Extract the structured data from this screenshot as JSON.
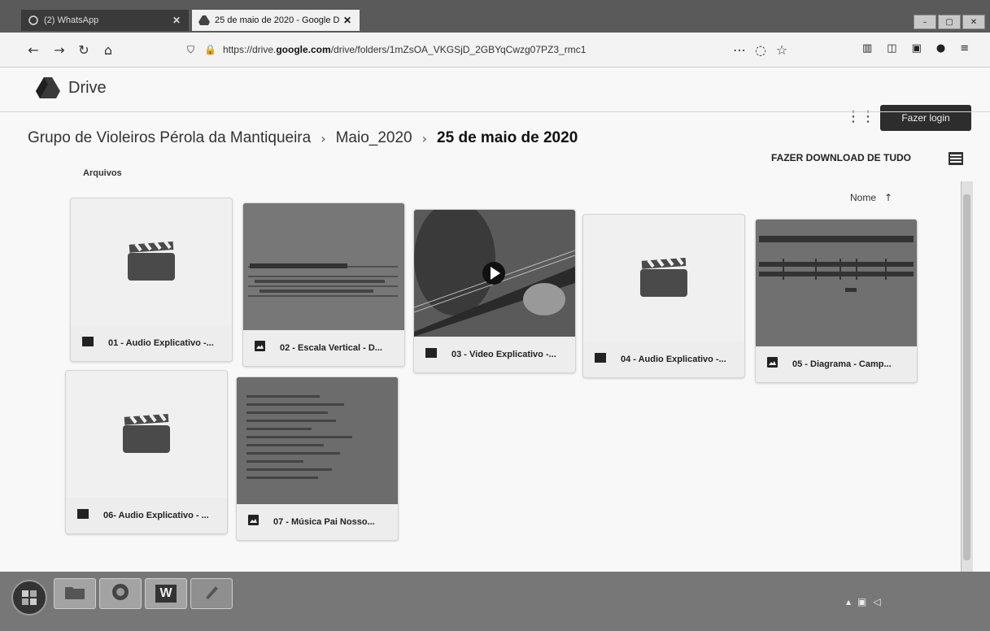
{
  "browser": {
    "tabs": [
      {
        "label": "(2) WhatsApp",
        "close": "✕"
      },
      {
        "label": "25 de maio de 2020 - Google D",
        "close": "✕"
      }
    ],
    "url_prefix": "https://drive.",
    "url_domain": "google.com",
    "url_path": "/drive/folders/1mZsOA_VKGSjD_2GBYqCwzg07PZ3_rmc1",
    "window_controls": [
      "–",
      "▢",
      "✕"
    ]
  },
  "drive": {
    "logo_text": "Drive",
    "login_label": "Fazer login",
    "breadcrumb": [
      "Grupo de Violeiros Pérola da Mantiqueira",
      "Maio_2020",
      "25 de maio de 2020"
    ],
    "breadcrumb_sep": "›",
    "download_all": "FAZER DOWNLOAD DE TUDO",
    "section_label": "Arquivos",
    "sort_label": "Nome",
    "sort_arrow": "↑",
    "files": [
      {
        "name": "01 - Audio Explicativo -...",
        "type": "video-icon"
      },
      {
        "name": "02 - Escala Vertical - D...",
        "type": "image-icon"
      },
      {
        "name": "03 - Video Explicativo -...",
        "type": "video-icon"
      },
      {
        "name": "04 - Audio Explicativo -...",
        "type": "video-icon"
      },
      {
        "name": "05 - Diagrama - Camp...",
        "type": "image-icon"
      },
      {
        "name": "06- Audio Explicativo - ...",
        "type": "video-icon"
      },
      {
        "name": "07 - Música Pai Nosso...",
        "type": "image-icon"
      }
    ]
  },
  "taskbar": {
    "word_label": "W"
  },
  "colors": {
    "accent_dark": "#2d2d2d",
    "page_bg": "#f8f8f8"
  }
}
